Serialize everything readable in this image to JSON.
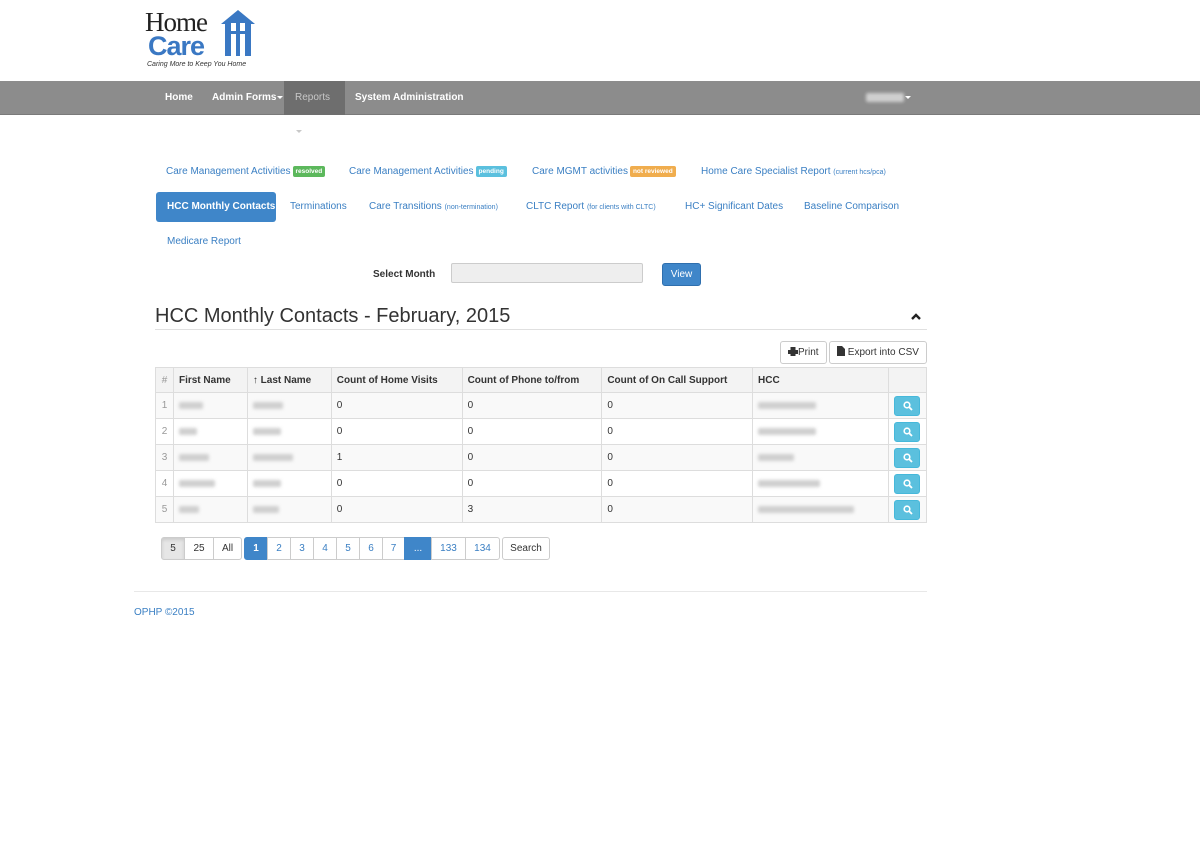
{
  "logo": {
    "line1": "Home",
    "line2": "Care",
    "tagline": "Caring More to Keep You Home"
  },
  "navbar": {
    "items": [
      {
        "label": "Home"
      },
      {
        "label": "Admin Forms"
      },
      {
        "label": "Reports"
      },
      {
        "label": "System Administration"
      }
    ]
  },
  "tabs": {
    "row1": [
      {
        "label": "Care Management Activities",
        "badge": "resolved",
        "badge_color": "#5cb85c"
      },
      {
        "label": "Care Management Activities",
        "badge": "pending",
        "badge_color": "#5bc0de"
      },
      {
        "label": "Care MGMT activities",
        "badge": "not reviewed",
        "badge_color": "#f0ad4e"
      },
      {
        "label": "Home Care Specialist Report",
        "note": "(current hcs/pca)"
      }
    ],
    "row2": [
      {
        "label": "HCC Monthly Contacts"
      },
      {
        "label": "Terminations"
      },
      {
        "label": "Care Transitions",
        "note": "(non-termination)"
      },
      {
        "label": "CLTC Report",
        "note": "(for clients with CLTC)"
      },
      {
        "label": "HC+ Significant Dates"
      },
      {
        "label": "Baseline Comparison"
      }
    ],
    "row3": [
      {
        "label": "Medicare Report"
      }
    ]
  },
  "month_selector": {
    "label": "Select Month",
    "value": "",
    "button": "View"
  },
  "panel": {
    "title": "HCC Monthly Contacts - February, 2015",
    "print": "Print",
    "export": "Export into CSV"
  },
  "table": {
    "headers": [
      "#",
      "First Name",
      "↑ Last Name",
      "Count of Home Visits",
      "Count of Phone to/from",
      "Count of On Call Support",
      "HCC",
      ""
    ],
    "rows": [
      {
        "n": "1",
        "home_visits": "0",
        "phone": "0",
        "on_call": "0"
      },
      {
        "n": "2",
        "home_visits": "0",
        "phone": "0",
        "on_call": "0"
      },
      {
        "n": "3",
        "home_visits": "1",
        "phone": "0",
        "on_call": "0"
      },
      {
        "n": "4",
        "home_visits": "0",
        "phone": "0",
        "on_call": "0"
      },
      {
        "n": "5",
        "home_visits": "0",
        "phone": "3",
        "on_call": "0"
      }
    ]
  },
  "pagination": {
    "sizes": [
      "5",
      "25",
      "All"
    ],
    "pages": [
      "1",
      "2",
      "3",
      "4",
      "5",
      "6",
      "7",
      "...",
      "133",
      "134"
    ],
    "search": "Search"
  },
  "footer": {
    "text": "OPHP ©2015"
  },
  "colors": {
    "primary": "#3f86c9",
    "navbar": "#8c8c8c",
    "info": "#5bc0de"
  }
}
